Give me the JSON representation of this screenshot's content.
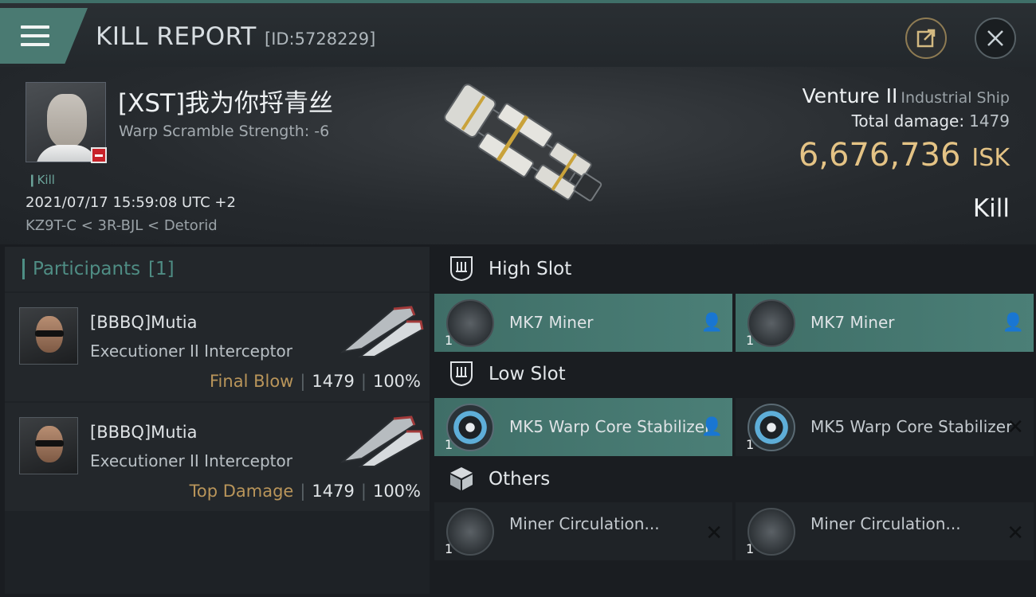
{
  "header": {
    "title": "KILL REPORT",
    "report_id": "[ID:5728229]",
    "share_icon": "share-icon",
    "close_icon": "close-icon"
  },
  "victim": {
    "name": "[XST]我为你捋青丝",
    "warp_scramble": "Warp Scramble Strength: -6",
    "kill_tag": "Kill",
    "timestamp": "2021/07/17 15:59:08 UTC +2",
    "location": "KZ9T-C < 3R-BJL < Detorid",
    "status_color": "#c8232a"
  },
  "ship": {
    "name": "Venture II",
    "class": "Industrial Ship",
    "total_damage_label": "Total damage:",
    "total_damage_value": "1479",
    "isk_value": "6,676,736",
    "isk_unit": "ISK",
    "result_label": "Kill"
  },
  "participants": {
    "title": "Participants",
    "count": "[1]",
    "items": [
      {
        "name": "[BBBQ]Mutia",
        "ship": "Executioner II Interceptor",
        "tag": "Final Blow",
        "damage": "1479",
        "percent": "100%"
      },
      {
        "name": "[BBBQ]Mutia",
        "ship": "Executioner II Interceptor",
        "tag": "Top Damage",
        "damage": "1479",
        "percent": "100%"
      }
    ]
  },
  "fittings": {
    "high_slot": {
      "title": "High Slot",
      "modules": [
        {
          "name": "MK7 Miner",
          "qty": "1",
          "status": "fitted"
        },
        {
          "name": "MK7 Miner",
          "qty": "1",
          "status": "fitted"
        }
      ]
    },
    "low_slot": {
      "title": "Low Slot",
      "modules": [
        {
          "name": "MK5 Warp Core Stabilizer",
          "qty": "1",
          "status": "fitted"
        },
        {
          "name": "MK5 Warp Core Stabilizer",
          "qty": "1",
          "status": "destroyed"
        }
      ]
    },
    "others": {
      "title": "Others",
      "modules": [
        {
          "name": "Miner Circulation...",
          "qty": "1",
          "status": "destroyed"
        },
        {
          "name": "Miner Circulation...",
          "qty": "1",
          "status": "destroyed"
        }
      ]
    }
  },
  "colors": {
    "accent_teal": "#4a7a72",
    "isk_gold": "#e4c385",
    "tag_gold": "#b9955a"
  }
}
